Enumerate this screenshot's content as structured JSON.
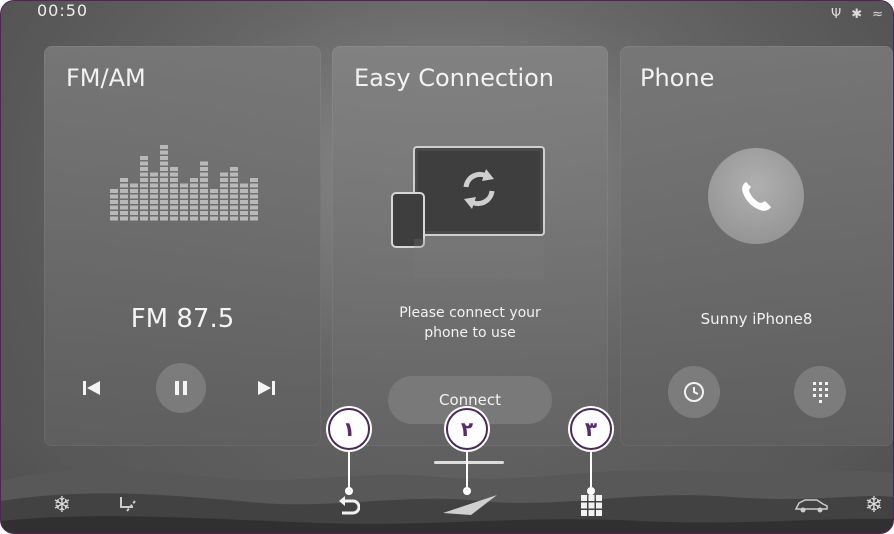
{
  "status_bar": {
    "time": "00:50",
    "icons": [
      "usb-icon",
      "bluetooth-icon",
      "wifi-icon"
    ]
  },
  "cards": {
    "radio": {
      "title": "FM/AM",
      "frequency": "FM 87.5",
      "controls": [
        "previous-icon",
        "pause-icon",
        "next-icon"
      ]
    },
    "easy_connection": {
      "title": "Easy Connection",
      "message_line1": "Please connect your",
      "message_line2": "phone to use",
      "connect_label": "Connect"
    },
    "phone": {
      "title": "Phone",
      "device_name": "Sunny iPhone8",
      "buttons": [
        "recent-calls-icon",
        "keypad-icon"
      ]
    }
  },
  "bottom_bar": {
    "icons": [
      "climate-fan-icon",
      "seat-airflow-icon",
      "back-icon",
      "navigation-icon",
      "all-menus-icon",
      "car-icon",
      "fan-icon"
    ]
  },
  "callouts": [
    "١",
    "٢",
    "٣"
  ],
  "colors": {
    "frame_border": "#5a1e5a",
    "callout_text": "#5a2a6a",
    "card_bg": "#777777"
  }
}
